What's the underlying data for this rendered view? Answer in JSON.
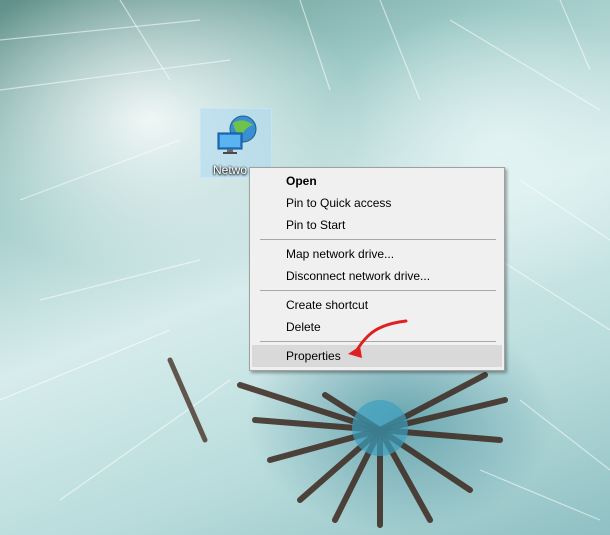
{
  "desktop": {
    "network_icon": {
      "label": "Netwo",
      "icon": "network-computer-icon"
    }
  },
  "context_menu": {
    "groups": [
      [
        {
          "label": "Open",
          "bold": true
        },
        {
          "label": "Pin to Quick access"
        },
        {
          "label": "Pin to Start"
        }
      ],
      [
        {
          "label": "Map network drive..."
        },
        {
          "label": "Disconnect network drive..."
        }
      ],
      [
        {
          "label": "Create shortcut"
        },
        {
          "label": "Delete"
        }
      ],
      [
        {
          "label": "Properties",
          "highlighted": true
        }
      ]
    ]
  },
  "annotation": {
    "icon": "red-arrow-icon",
    "color": "#e02020"
  },
  "colors": {
    "menu_bg": "#f0f0f0",
    "menu_border": "#a0a0a0",
    "highlight": "#d9d9d9"
  }
}
